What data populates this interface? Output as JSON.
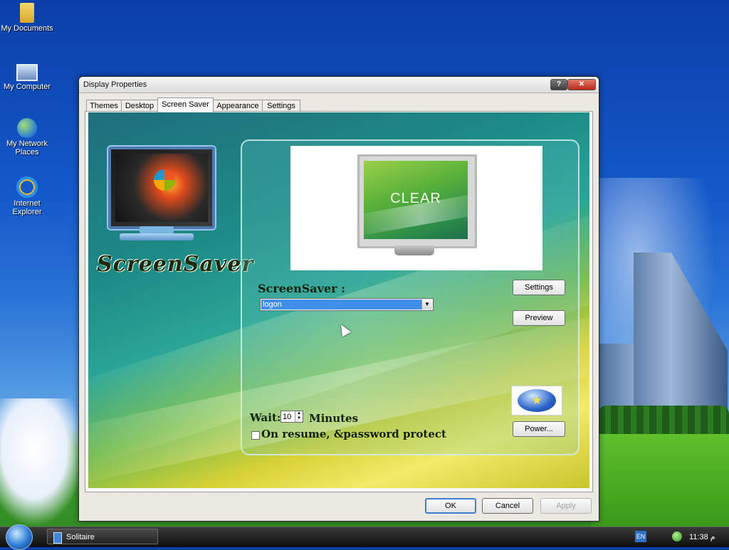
{
  "desktop": {
    "icons": [
      {
        "label": "My Documents",
        "icon": "folder-icon"
      },
      {
        "label": "My Computer",
        "icon": "computer-icon"
      },
      {
        "label": "My Network Places",
        "icon": "network-icon"
      },
      {
        "label": "Internet Explorer",
        "icon": "ie-icon"
      }
    ]
  },
  "window": {
    "title": "Display Properties",
    "help_label": "?",
    "close_label": "✕",
    "tabs": [
      {
        "label": "Themes"
      },
      {
        "label": "Desktop"
      },
      {
        "label": "Screen Saver",
        "active": true
      },
      {
        "label": "Appearance"
      },
      {
        "label": "Settings"
      }
    ],
    "brand_title": "ScreenSaver",
    "preview_text": "CLEAR",
    "screensaver_label": "ScreenSaver :",
    "screensaver_value": "logon",
    "settings_label": "Settings",
    "preview_label": "Preview",
    "power_label": "Power...",
    "wait_label": "Wait:",
    "wait_value": "10",
    "minutes_label": "Minutes",
    "resume_label": "On resume, &password protect",
    "resume_checked": false,
    "ok_label": "OK",
    "cancel_label": "Cancel",
    "apply_label": "Apply"
  },
  "taskbar": {
    "task_label": "Solitaire",
    "lang": "EN",
    "clock": "11:38 م"
  },
  "colors": {
    "accent": "#3f8fe8",
    "taskbar": "#1a1a1a"
  }
}
